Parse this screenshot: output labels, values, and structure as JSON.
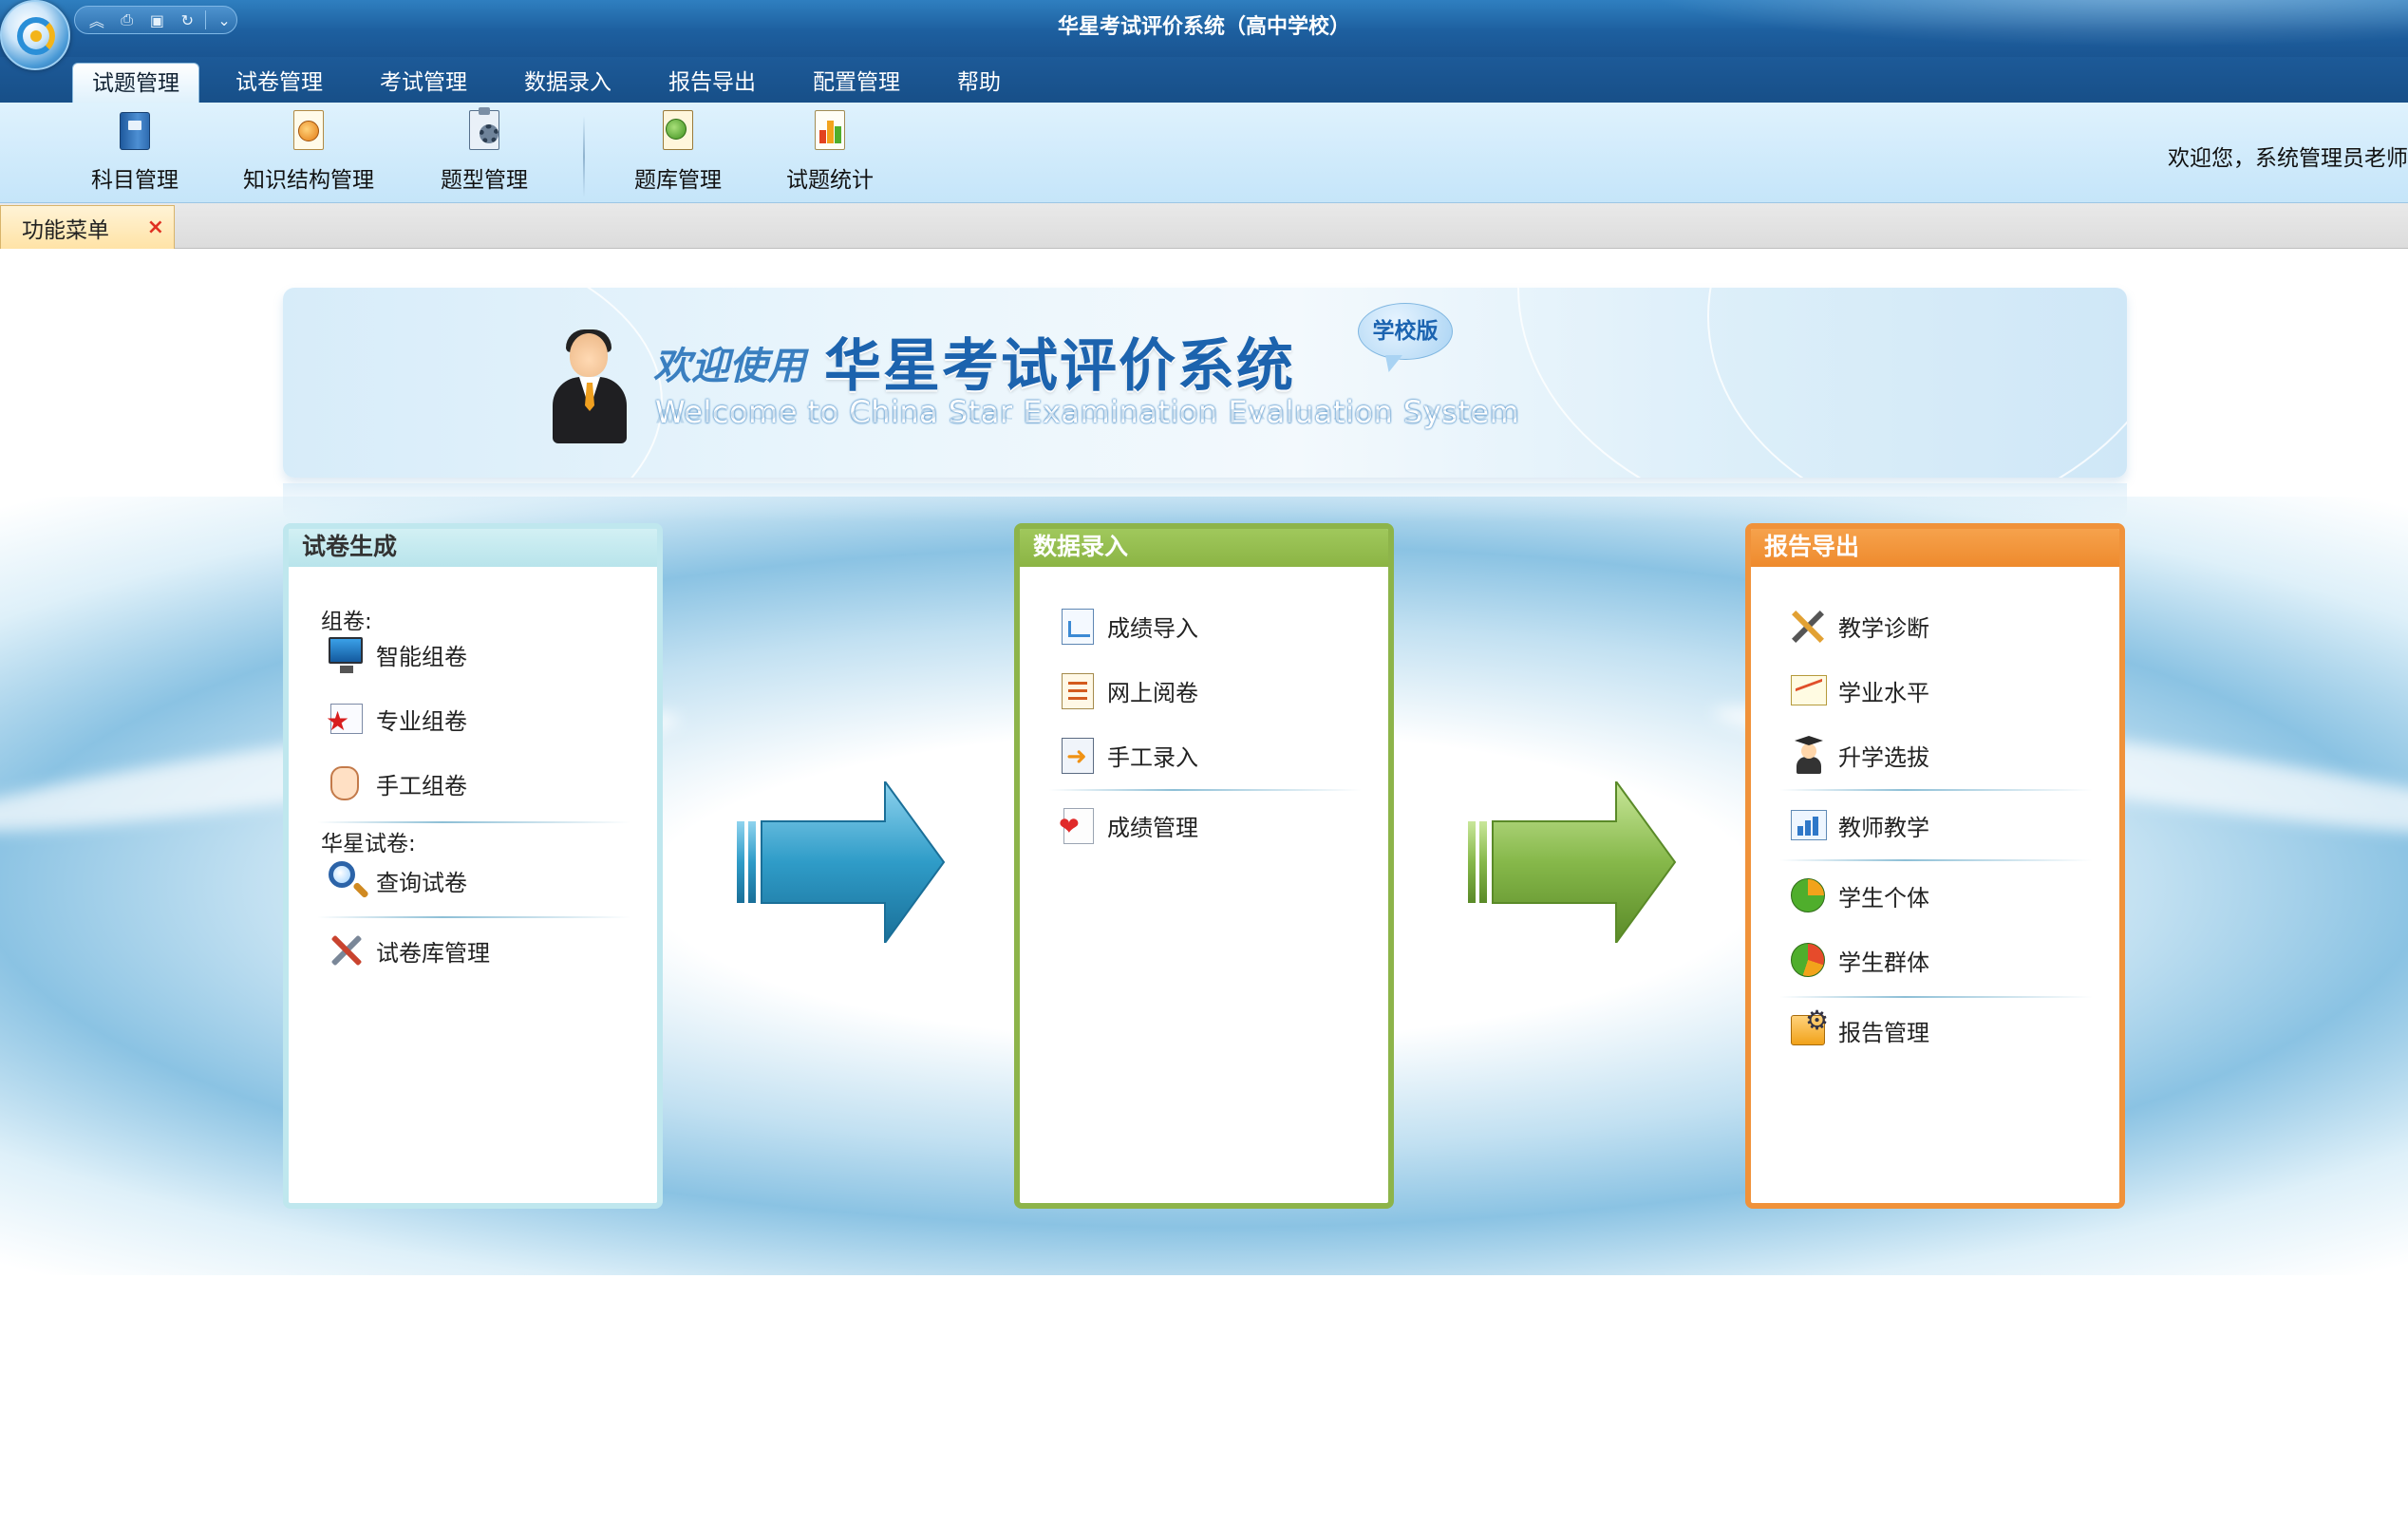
{
  "window": {
    "title": "华星考试评价系统（高中学校）"
  },
  "quick_access": {
    "icons": [
      "collapse-icon",
      "print-icon",
      "save-icon",
      "refresh-icon",
      "dropdown-icon"
    ]
  },
  "tabs": [
    {
      "label": "试题管理",
      "active": true
    },
    {
      "label": "试卷管理"
    },
    {
      "label": "考试管理"
    },
    {
      "label": "数据录入"
    },
    {
      "label": "报告导出"
    },
    {
      "label": "配置管理"
    },
    {
      "label": "帮助"
    }
  ],
  "ribbon": {
    "buttons": [
      {
        "label": "科目管理",
        "icon": "book-icon"
      },
      {
        "label": "知识结构管理",
        "icon": "knowledge-doc-icon"
      },
      {
        "label": "题型管理",
        "icon": "clipboard-gear-icon"
      },
      {
        "label": "题库管理",
        "icon": "key-doc-icon"
      },
      {
        "label": "试题统计",
        "icon": "bar-chart-doc-icon"
      }
    ],
    "welcome": "欢迎您，系统管理员老师"
  },
  "doc_tab": {
    "label": "功能菜单",
    "close": "×"
  },
  "banner": {
    "welcome": "欢迎使用",
    "title": "华星考试评价系统",
    "subtitle": "Welcome to China Star Examination Evaluation System",
    "badge": "学校版"
  },
  "panels": {
    "paper": {
      "title": "试卷生成",
      "group1": "组卷:",
      "items1": [
        {
          "label": "智能组卷",
          "icon": "monitor-icon"
        },
        {
          "label": "专业组卷",
          "icon": "star-card-icon"
        },
        {
          "label": "手工组卷",
          "icon": "hand-icon"
        }
      ],
      "group2": "华星试卷:",
      "items2": [
        {
          "label": "查询试卷",
          "icon": "magnifier-icon"
        },
        {
          "label": "试卷库管理",
          "icon": "tools-icon"
        }
      ]
    },
    "data": {
      "title": "数据录入",
      "items": [
        {
          "label": "成绩导入",
          "icon": "chart-import-icon"
        },
        {
          "label": "网上阅卷",
          "icon": "list-doc-icon"
        },
        {
          "label": "手工录入",
          "icon": "arrow-window-icon"
        },
        {
          "label": "成绩管理",
          "icon": "heart-doc-icon"
        }
      ]
    },
    "report": {
      "title": "报告导出",
      "items": [
        {
          "label": "教学诊断",
          "icon": "cross-tools-icon"
        },
        {
          "label": "学业水平",
          "icon": "line-chart-icon"
        },
        {
          "label": "升学选拔",
          "icon": "graduate-icon"
        },
        {
          "label": "教师教学",
          "icon": "bar-chart-icon"
        },
        {
          "label": "学生个体",
          "icon": "pie-chart-icon"
        },
        {
          "label": "学生群体",
          "icon": "pie-chart-multi-icon"
        },
        {
          "label": "报告管理",
          "icon": "gear-box-icon"
        }
      ]
    }
  },
  "colors": {
    "titlebar": "#1d5f9f",
    "panel_paper": "#bfe7ee",
    "panel_data": "#8db44a",
    "panel_report": "#f0923a",
    "arrow_blue": "#2f9cc8",
    "arrow_green": "#86b84a"
  }
}
